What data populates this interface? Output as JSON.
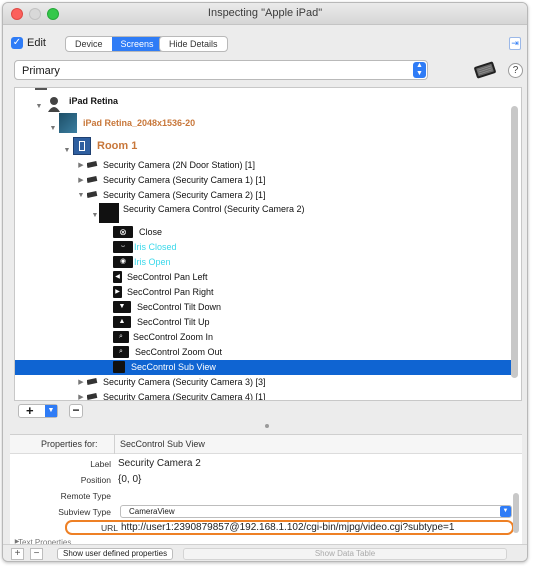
{
  "window": {
    "title": "Inspecting \"Apple iPad\""
  },
  "toolbar": {
    "edit_checked": true,
    "edit_label": "Edit",
    "segments": [
      "Device",
      "Screens"
    ],
    "active_segment": "Screens",
    "hide_details_label": "Hide Details"
  },
  "selector": {
    "value": "Primary",
    "help_label": "?"
  },
  "tree": {
    "root": "iPad Retina",
    "background": "iPad Retina_2048x1536-20",
    "room": "Room 1",
    "cameras_top": [
      "Security Camera (2N Door Station) [1]",
      "Security Camera (Security Camera 1) [1]",
      "Security Camera (Security Camera 2) [1]"
    ],
    "control_group": "Security Camera Control (Security Camera 2)",
    "controls": [
      "Close",
      "Iris Closed",
      "Iris Open",
      "SecControl Pan Left",
      "SecControl Pan Right",
      "SecControl Tilt Down",
      "SecControl Tilt Up",
      "SecControl Zoom In",
      "SecControl Zoom Out",
      "SecControl Sub View"
    ],
    "selected": "SecControl Sub View",
    "cameras_bottom": [
      "Security Camera (Security Camera 3) [3]",
      "Security Camera (Security Camera 4) [1]"
    ]
  },
  "properties": {
    "for_label": "Properties for:",
    "for_value": "SecControl Sub View",
    "rows": [
      {
        "key": "Label",
        "value": "Security Camera 2"
      },
      {
        "key": "Position",
        "value": "{0, 0}"
      },
      {
        "key": "Remote Type",
        "value": ""
      }
    ],
    "subview_type_key": "Subview Type",
    "subview_type_value": "CameraView",
    "url_key": "URL",
    "url_value": "http://user1:2390879857@192.168.1.102/cgi-bin/mjpg/video.cgi?subtype=1",
    "text_properties": "Text Properties",
    "highlight_color": "#ee8025"
  },
  "bottombar": {
    "plus": "+",
    "minus": "−",
    "show_user_defined": "Show user defined properties",
    "show_data_table": "Show Data Table"
  },
  "colors": {
    "accent": "#2f7cf6",
    "selection": "#0f64d2",
    "cyan_text": "#3ad8ea",
    "orange_text": "#c8773a"
  }
}
